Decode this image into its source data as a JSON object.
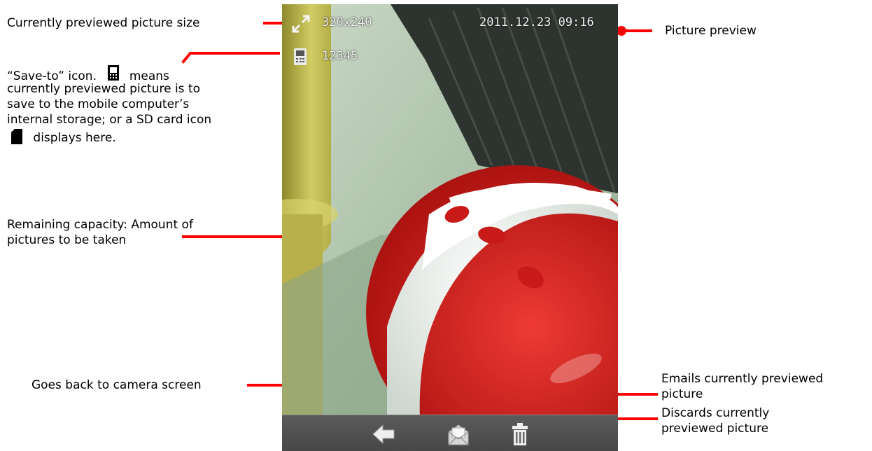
{
  "annotations": {
    "picture_size": "Currently previewed picture size",
    "save_to_line1": "“Save-to” icon.",
    "save_to_means": "means",
    "save_to_line2": "currently previewed picture is to",
    "save_to_line3": "save to the mobile computer’s",
    "save_to_line4": "internal storage; or a SD card icon",
    "save_to_line5": "displays here.",
    "remaining_line1": "Remaining capacity: Amount of",
    "remaining_line2": "pictures to be taken",
    "back": "Goes back to camera screen",
    "picture_preview": "Picture preview",
    "email_line1": "Emails currently previewed",
    "email_line2": "picture",
    "discard_line1": "Discards currently",
    "discard_line2": "previewed picture"
  },
  "screen": {
    "picture_size": "320x240",
    "datetime": "2011.12.23 09:16",
    "remaining_capacity": "12345",
    "icons": {
      "size": "resize-icon",
      "storage": "mobile-device-icon",
      "back": "back-arrow-icon",
      "email": "email-icon",
      "discard": "trash-icon"
    }
  },
  "colors": {
    "callout_line": "#ff0000",
    "toolbar": "#4f4f4f",
    "ball_red": "#d9211e"
  }
}
